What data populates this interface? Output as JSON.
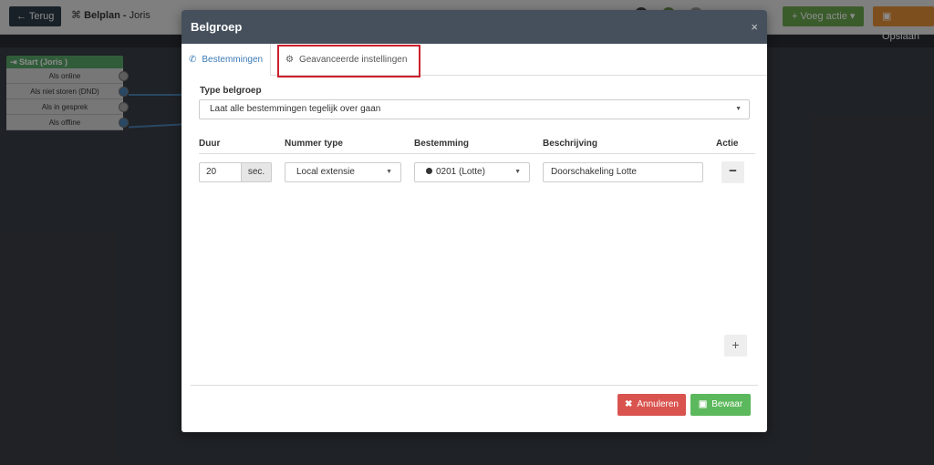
{
  "topbar": {
    "back_label": "← Terug",
    "plan_label": "Belplan -",
    "plan_name": "Joris",
    "add_action_label": "Voeg actie",
    "save_label": "Opslaan"
  },
  "canvas": {
    "start_node": {
      "title": "Start (Joris )",
      "rows": [
        "Als online",
        "Als niet storen (DND)",
        "Als in gesprek",
        "Als offline"
      ]
    }
  },
  "modal": {
    "title": "Belgroep",
    "close_icon": "×",
    "tabs": [
      {
        "label": "Bestemmingen",
        "icon": "phone-icon",
        "active": true
      },
      {
        "label": "Geavanceerde instellingen",
        "icon": "gear-icon",
        "active": false
      }
    ],
    "type_label": "Type belgroep",
    "type_value": "Laat alle bestemmingen tegelijk over gaan",
    "columns": [
      "Duur",
      "Nummer type",
      "Bestemming",
      "Beschrijving",
      "Actie"
    ],
    "rows": [
      {
        "duration": "20",
        "duration_unit": "sec.",
        "number_type": "Local extensie",
        "destination": "0201 (Lotte)",
        "description": "Doorschakeling Lotte"
      }
    ],
    "cancel_label": "Annuleren",
    "save_label": "Bewaar"
  },
  "colors": {
    "header_bg": "#45505c",
    "highlight": "#cc1f2d",
    "cancel": "#d9534f",
    "save": "#5cb85c",
    "add_action": "#6aa84f",
    "topbar_save": "#e69138"
  }
}
